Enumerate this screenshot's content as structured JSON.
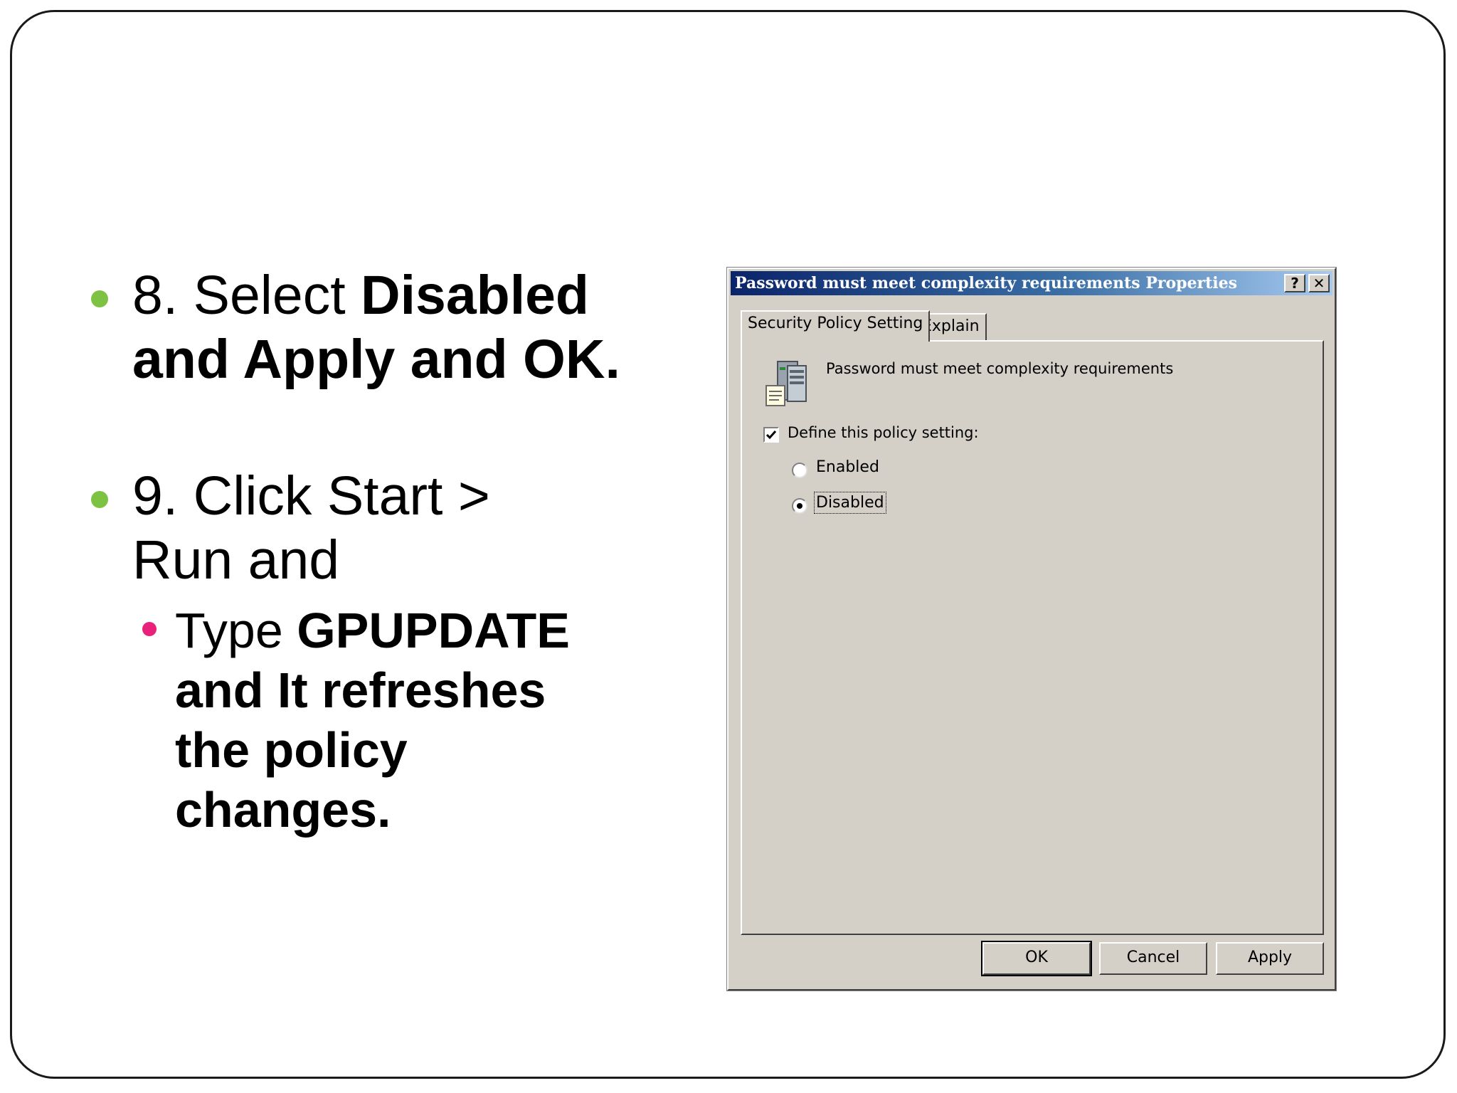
{
  "bullets": [
    {
      "normal": "8. Select ",
      "bold": "Disabled and Apply and OK.",
      "color": "#7dc242"
    },
    {
      "normal": "9. Click Start  > Run and",
      "bold": "",
      "color": "#7dc242"
    }
  ],
  "sub_bullet": {
    "normal": "Type ",
    "bold": "GPUPDATE and It refreshes the policy changes.",
    "color": "#e8217a"
  },
  "dialog": {
    "title": "Password must meet complexity requirements Properties",
    "help_label": "?",
    "close_label": "✕",
    "tabs": [
      "Security Policy Setting",
      "Explain"
    ],
    "policy_name": "Password must meet complexity requirements",
    "define_label": "Define this policy setting:",
    "define_checked": true,
    "radios": [
      {
        "label": "Enabled",
        "selected": false
      },
      {
        "label": "Disabled",
        "selected": true
      }
    ],
    "buttons": {
      "ok": "OK",
      "cancel": "Cancel",
      "apply": "Apply"
    },
    "icon": "server-policy-icon"
  }
}
